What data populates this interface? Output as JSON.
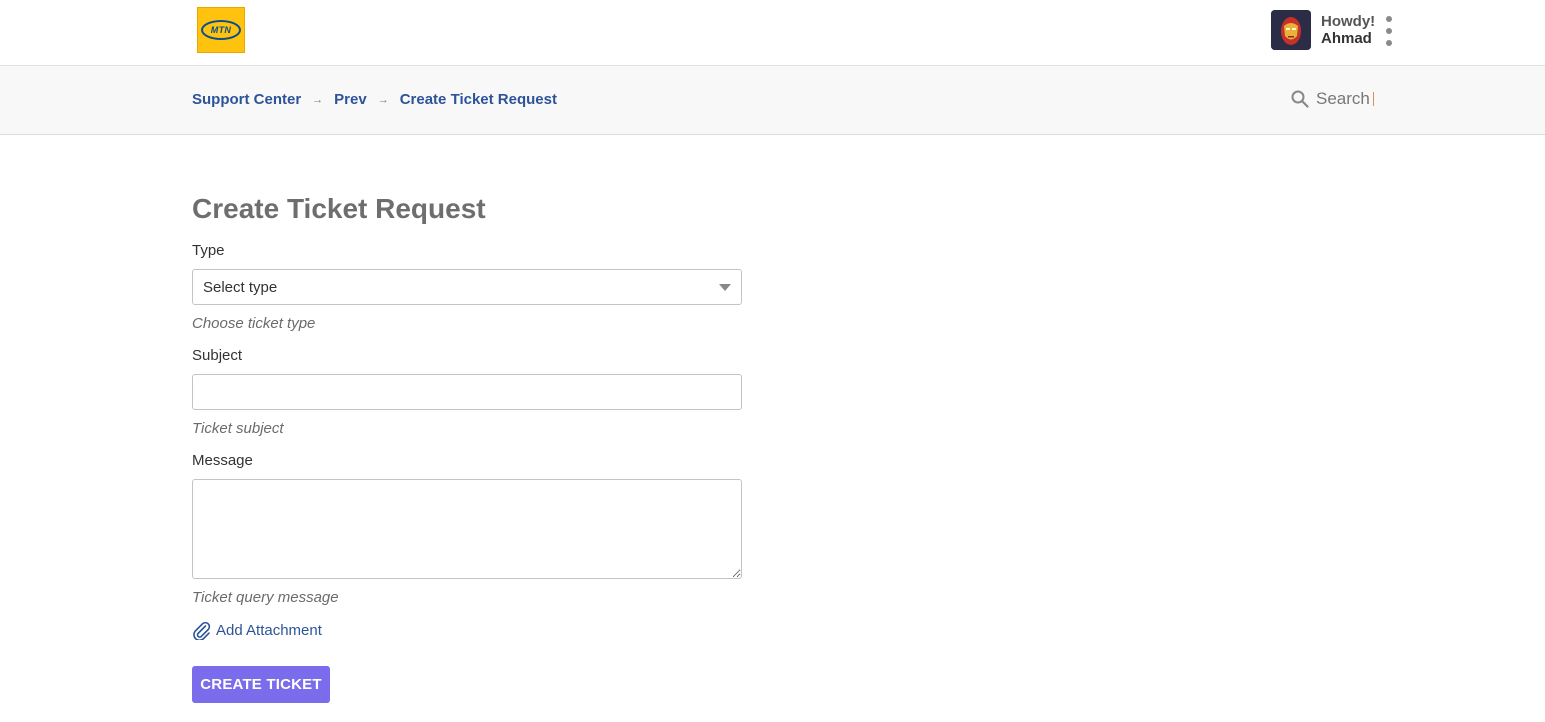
{
  "header": {
    "logo_text": "MTN",
    "greeting": "Howdy!",
    "username": "Ahmad"
  },
  "breadcrumb": {
    "items": [
      "Support Center",
      "Prev",
      "Create Ticket Request"
    ]
  },
  "search": {
    "placeholder": "Search"
  },
  "form": {
    "title": "Create Ticket Request",
    "type_label": "Type",
    "type_selected": "Select type",
    "type_hint": "Choose ticket type",
    "subject_label": "Subject",
    "subject_value": "",
    "subject_hint": "Ticket subject",
    "message_label": "Message",
    "message_value": "",
    "message_hint": "Ticket query message",
    "attachment_label": "Add Attachment",
    "submit_label": "CREATE TICKET"
  },
  "colors": {
    "accent": "#7b6cec",
    "link": "#2d5498",
    "logo_bg": "#ffc20e"
  },
  "icons": [
    "menu-dots-icon",
    "breadcrumb-arrow-icon",
    "search-icon",
    "select-caret-icon",
    "paperclip-icon",
    "avatar-icon"
  ]
}
